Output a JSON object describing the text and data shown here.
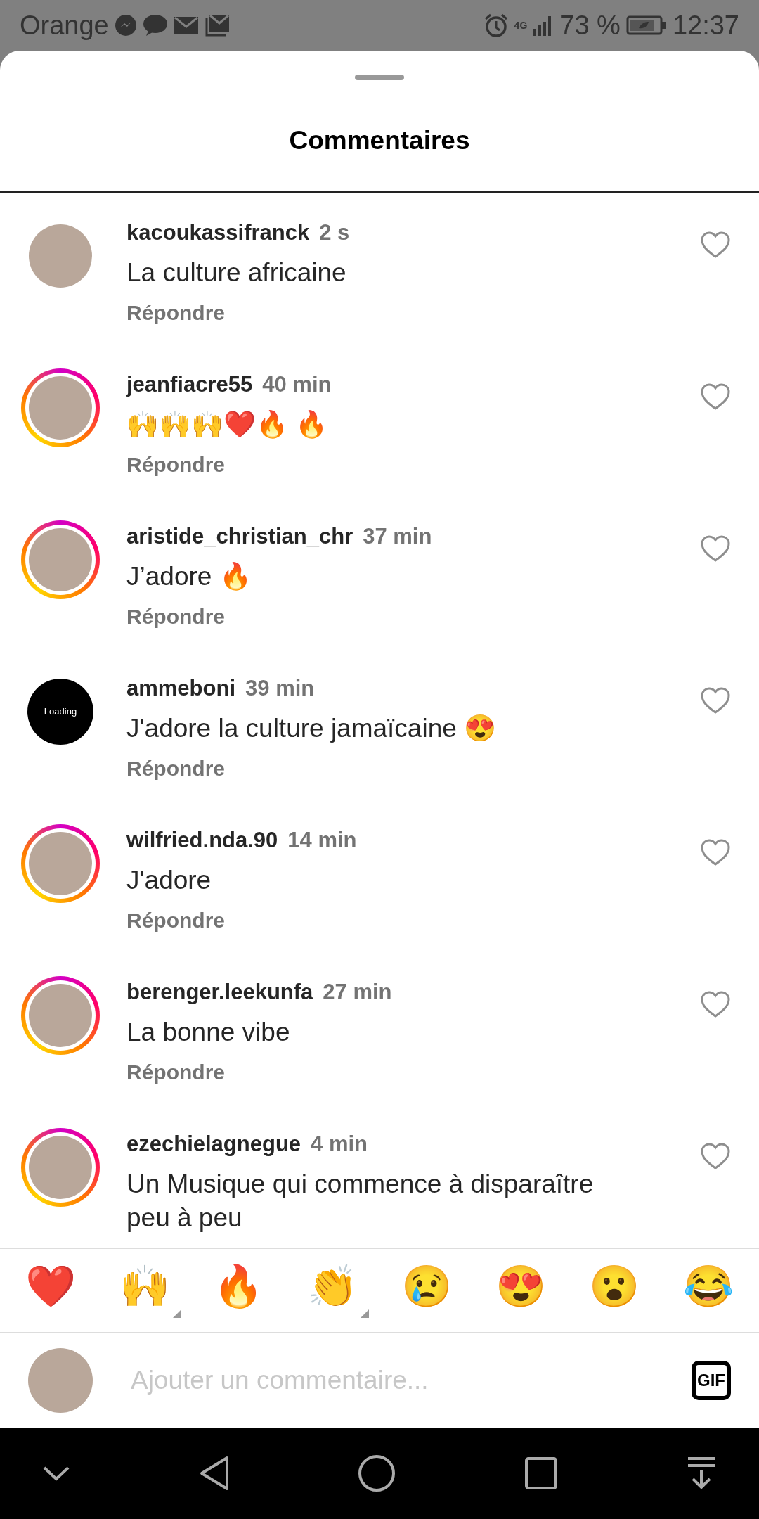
{
  "status_bar": {
    "carrier": "Orange",
    "network": "4G",
    "battery": "73 %",
    "time": "12:37"
  },
  "title": "Commentaires",
  "comments": [
    {
      "kind": "photo",
      "username": "kacoukassifranck",
      "time": "2 s",
      "text": "La culture africaine",
      "reply": "Répondre",
      "story_ring": false
    },
    {
      "kind": "photo",
      "username": "jeanfiacre55",
      "time": "40 min",
      "text": "🙌🙌🙌❤️🔥 🔥",
      "reply": "Répondre",
      "story_ring": true
    },
    {
      "kind": "photo",
      "username": "aristide_christian_chr",
      "time": "37 min",
      "text": "J’adore 🔥",
      "reply": "Répondre",
      "story_ring": true
    },
    {
      "kind": "loading",
      "avatar_text": "Loading",
      "username": "ammeboni",
      "time": "39 min",
      "text": "J'adore la culture jamaïcaine 😍",
      "reply": "Répondre",
      "story_ring": false
    },
    {
      "kind": "photo",
      "username": "wilfried.nda.90",
      "time": "14 min",
      "text": "J'adore",
      "reply": "Répondre",
      "story_ring": true
    },
    {
      "kind": "photo",
      "username": "berenger.leekunfa",
      "time": "27 min",
      "text": "La bonne vibe",
      "reply": "Répondre",
      "story_ring": true
    },
    {
      "kind": "photo",
      "username": "ezechielagnegue",
      "time": "4 min",
      "text": "Un Musique qui commence à disparaître peu à peu",
      "story_ring": true
    }
  ],
  "reactions": [
    {
      "emoji": "❤️",
      "has_variants": false
    },
    {
      "emoji": "🙌",
      "has_variants": true
    },
    {
      "emoji": "🔥",
      "has_variants": false
    },
    {
      "emoji": "👏",
      "has_variants": true
    },
    {
      "emoji": "😢",
      "has_variants": false
    },
    {
      "emoji": "😍",
      "has_variants": false
    },
    {
      "emoji": "😮",
      "has_variants": false
    },
    {
      "emoji": "😂",
      "has_variants": false
    }
  ],
  "composer": {
    "placeholder": "Ajouter un commentaire...",
    "gif": "GIF"
  }
}
